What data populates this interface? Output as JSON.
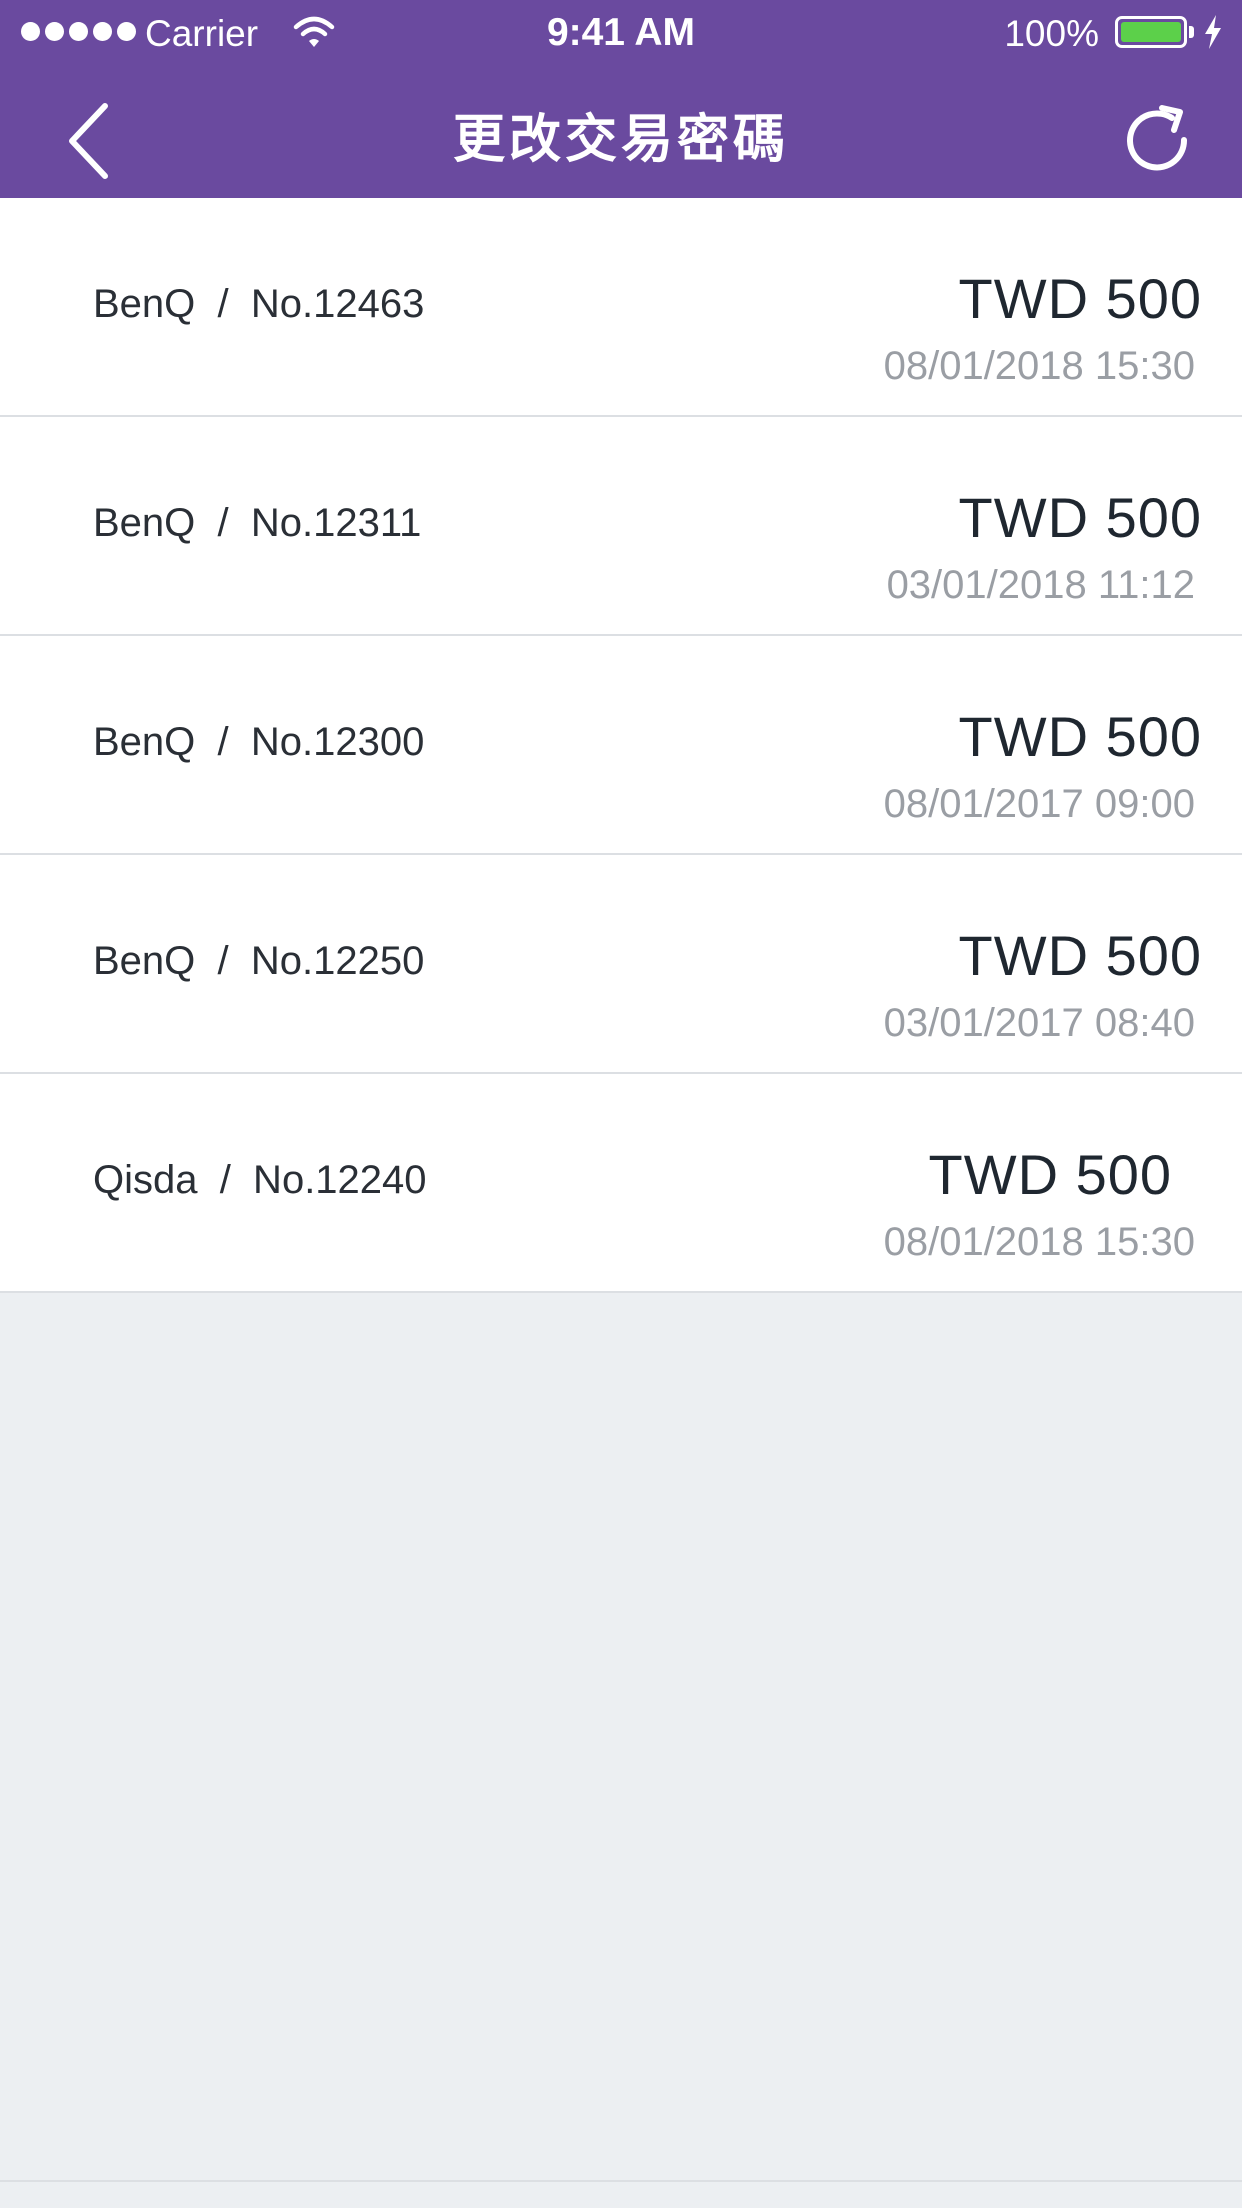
{
  "status_bar": {
    "carrier": "Carrier",
    "time": "9:41 AM",
    "battery": "100%",
    "icons": [
      "signal-dots-icon",
      "wifi-icon",
      "battery-icon",
      "charging-bolt-icon"
    ]
  },
  "nav": {
    "title": "更改交易密碼",
    "back_icon": "chevron-left-icon",
    "refresh_icon": "refresh-icon"
  },
  "transactions": [
    {
      "label": "BenQ  /  No.12463",
      "amount": "TWD 500",
      "date": "08/01/2018 15:30"
    },
    {
      "label": "BenQ  /  No.12311",
      "amount": "TWD 500",
      "date": "03/01/2018 11:12"
    },
    {
      "label": "BenQ  /  No.12300",
      "amount": "TWD 500",
      "date": "08/01/2017 09:00"
    },
    {
      "label": "BenQ  /  No.12250",
      "amount": "TWD 500",
      "date": "03/01/2017 08:40"
    },
    {
      "label": "Qisda  /  No.12240",
      "amount": "TWD 500",
      "date": "08/01/2018 15:30"
    }
  ],
  "colors": {
    "nav_background": "#6A4A9F",
    "page_background": "#ECEFF2",
    "amount_text": "#1F2730",
    "date_text": "#9A9EA4",
    "battery_fill": "#5CD04A"
  }
}
